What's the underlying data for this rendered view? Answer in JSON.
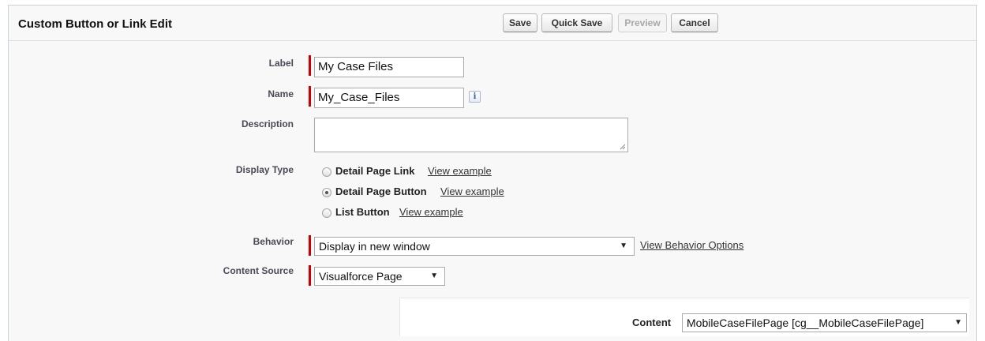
{
  "header": {
    "title": "Custom Button or Link Edit",
    "buttons": {
      "save": "Save",
      "quick_save": "Quick Save",
      "preview": "Preview",
      "cancel": "Cancel"
    }
  },
  "form": {
    "label": {
      "label": "Label",
      "value": "My Case Files"
    },
    "name": {
      "label": "Name",
      "value": "My_Case_Files",
      "info_icon_glyph": "i"
    },
    "description": {
      "label": "Description",
      "value": ""
    },
    "display_type": {
      "label": "Display Type",
      "options": [
        {
          "label": "Detail Page Link",
          "link": "View example",
          "selected": false
        },
        {
          "label": "Detail Page Button",
          "link": "View example",
          "selected": true
        },
        {
          "label": "List Button",
          "link": "View example",
          "selected": false
        }
      ]
    },
    "behavior": {
      "label": "Behavior",
      "value": "Display in new window",
      "link": "View Behavior Options"
    },
    "content_source": {
      "label": "Content Source",
      "value": "Visualforce Page"
    },
    "content": {
      "label": "Content",
      "value": "MobileCaseFilePage [cg__MobileCaseFilePage]"
    }
  },
  "colors": {
    "required_marker": "#cc0000",
    "header_bg": "#f8f8f8"
  },
  "icons": {
    "dropdown": "chevron-down-icon",
    "info": "info-icon",
    "resize": "resize-grip-icon"
  }
}
